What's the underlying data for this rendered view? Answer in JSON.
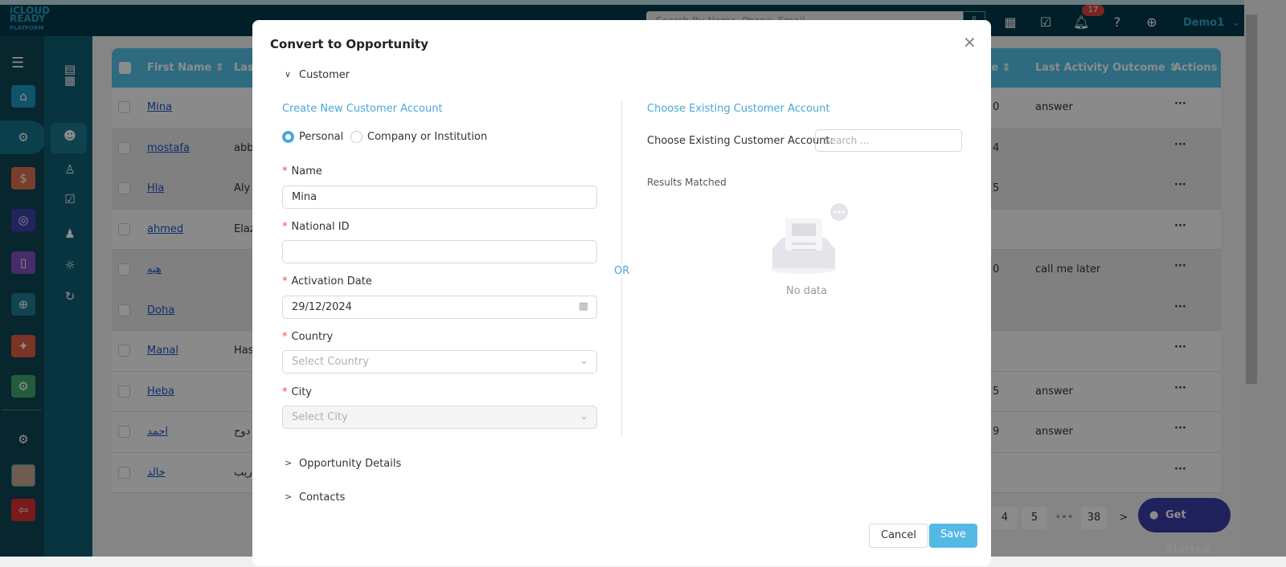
{
  "header": {
    "logo": "iCLOUD READY PLATFORM",
    "search_placeholder": "Search By Name, Phone, Email",
    "notifications": "17",
    "user": "Demo1"
  },
  "table": {
    "headers": [
      "First Name",
      "Last",
      "te",
      "Last Activity Outcome",
      "Actions"
    ],
    "rows": [
      {
        "first": "Mina",
        "last": "",
        "date": "0",
        "outcome": "answer"
      },
      {
        "first": "mostafa",
        "last": "abb",
        "date": "4",
        "outcome": ""
      },
      {
        "first": "Hla",
        "last": "Aly",
        "date": "5",
        "outcome": ""
      },
      {
        "first": "ahmed",
        "last": "Elaz",
        "date": "",
        "outcome": ""
      },
      {
        "first": "هبه",
        "last": "",
        "date": "0",
        "outcome": "call me later"
      },
      {
        "first": "Doha",
        "last": "",
        "date": "",
        "outcome": ""
      },
      {
        "first": "Manal",
        "last": "Hass",
        "date": "",
        "outcome": ""
      },
      {
        "first": "Heba",
        "last": "",
        "date": "5",
        "outcome": "answer"
      },
      {
        "first": "احمد",
        "last": "دوح",
        "date": "9",
        "outcome": "answer"
      },
      {
        "first": "خالد",
        "last": "ريب",
        "date": "",
        "outcome": ""
      }
    ],
    "actions": "···"
  },
  "pagination": [
    "4",
    "5",
    "•••",
    "38",
    ">"
  ],
  "get_started": "Get Started",
  "modal": {
    "title": "Convert to Opportunity",
    "sections": {
      "customer": "Customer",
      "opportunity": "Opportunity Details",
      "contacts": "Contacts"
    },
    "create_title": "Create New Customer Account",
    "radio": {
      "personal": "Personal",
      "company": "Company or Institution",
      "selected": "Personal"
    },
    "fields": {
      "name": {
        "label": "Name",
        "value": "Mina"
      },
      "national_id": {
        "label": "National ID",
        "value": ""
      },
      "activation_date": {
        "label": "Activation Date",
        "value": "29/12/2024"
      },
      "country": {
        "label": "Country",
        "placeholder": "Select Country"
      },
      "city": {
        "label": "City",
        "placeholder": "Select City"
      }
    },
    "or": "OR",
    "existing_title": "Choose Existing Customer Account",
    "existing_label": "Choose Existing Customer Account:",
    "existing_placeholder": "Search ...",
    "results": "Results Matched",
    "no_data": "No data",
    "cancel": "Cancel",
    "save": "Save"
  },
  "colors": {
    "accent": "#49a8d8",
    "header": "#55c3e9",
    "get_started": "#3a3fa8"
  }
}
